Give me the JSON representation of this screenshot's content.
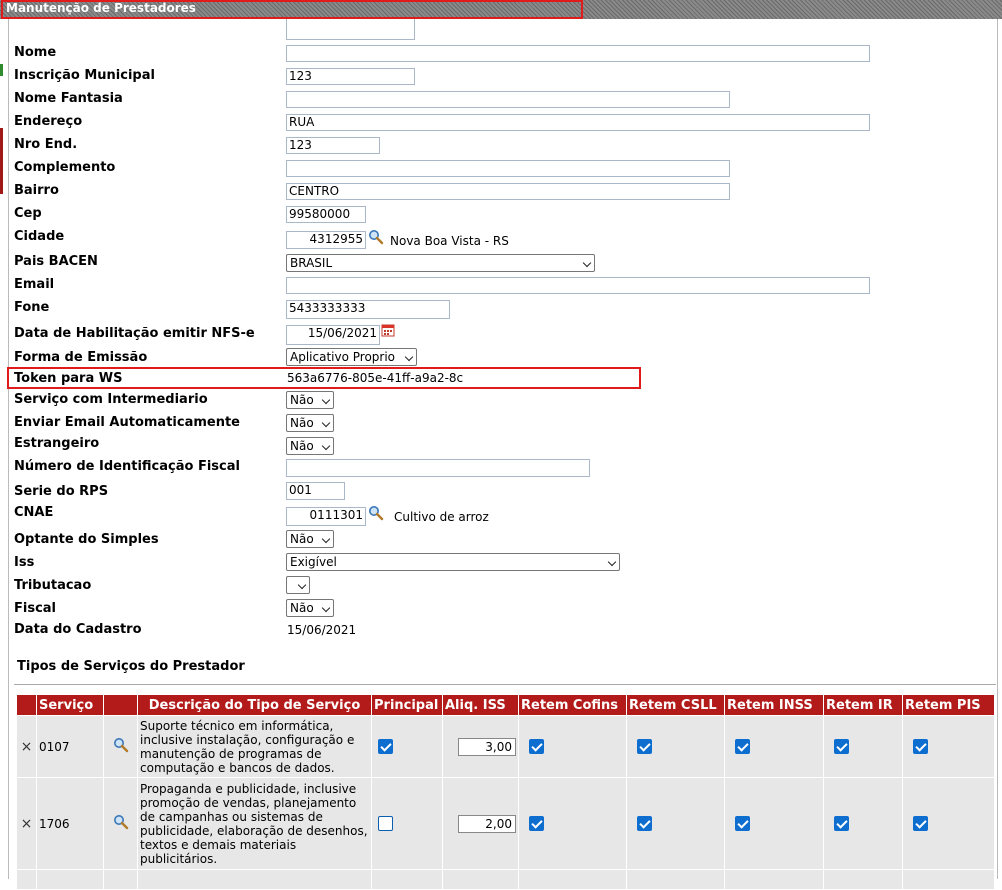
{
  "page": {
    "title": "Manutenção de Prestadores"
  },
  "form": {
    "nome": {
      "label": "Nome",
      "value": ""
    },
    "inscricao": {
      "label": "Inscrição Municipal",
      "value": "123"
    },
    "nome_fantasia": {
      "label": "Nome Fantasia",
      "value": ""
    },
    "endereco": {
      "label": "Endereço",
      "value": "RUA"
    },
    "nro": {
      "label": "Nro End.",
      "value": "123"
    },
    "complemento": {
      "label": "Complemento",
      "value": ""
    },
    "bairro": {
      "label": "Bairro",
      "value": "CENTRO"
    },
    "cep": {
      "label": "Cep",
      "value": "99580000"
    },
    "cidade": {
      "label": "Cidade",
      "code": "4312955",
      "name": "Nova Boa Vista - RS"
    },
    "pais": {
      "label": "Pais BACEN",
      "value": "BRASIL"
    },
    "email": {
      "label": "Email",
      "value": ""
    },
    "fone": {
      "label": "Fone",
      "value": "5433333333"
    },
    "data_hab": {
      "label": "Data de Habilitação emitir NFS-e",
      "value": "15/06/2021"
    },
    "forma": {
      "label": "Forma de Emissão",
      "value": "Aplicativo Proprio"
    },
    "token": {
      "label": "Token para WS",
      "value": "563a6776-805e-41ff-a9a2-8c"
    },
    "intermediario": {
      "label": "Serviço com Intermediario",
      "value": "Não"
    },
    "enviar_email": {
      "label": "Enviar Email Automaticamente",
      "value": "Não"
    },
    "estrangeiro": {
      "label": "Estrangeiro",
      "value": "Não"
    },
    "nif": {
      "label": "Número de Identificação Fiscal",
      "value": ""
    },
    "serie": {
      "label": "Serie do RPS",
      "value": "001"
    },
    "cnae": {
      "label": "CNAE",
      "code": "0111301",
      "name": "Cultivo de arroz"
    },
    "simples": {
      "label": "Optante do Simples",
      "value": "Não"
    },
    "iss": {
      "label": "Iss",
      "value": "Exigível"
    },
    "tributacao": {
      "label": "Tributacao",
      "value": ""
    },
    "fiscal": {
      "label": "Fiscal",
      "value": "Não"
    },
    "data_cadastro": {
      "label": "Data do Cadastro",
      "value": "15/06/2021"
    }
  },
  "services": {
    "title": "Tipos de Serviços do Prestador",
    "headers": [
      "",
      "Serviço",
      "",
      "Descrição do Tipo de Serviço",
      "Principal",
      "Aliq. ISS",
      "Retem Cofins",
      "Retem CSLL",
      "Retem INSS",
      "Retem IR",
      "Retem PIS"
    ],
    "rows": [
      {
        "code": "0107",
        "desc": "Suporte técnico em informática, inclusive instalação, configuração e manutenção de programas de computação e bancos de dados.",
        "principal": true,
        "aliq": "3,00",
        "cofins": true,
        "csll": true,
        "inss": true,
        "ir": true,
        "pis": true
      },
      {
        "code": "1706",
        "desc": "Propaganda e publicidade, inclusive promoção de vendas, planejamento de campanhas ou sistemas de publicidade, elaboração de desenhos, textos e demais materiais publicitários.",
        "principal": false,
        "aliq": "2,00",
        "cofins": true,
        "csll": true,
        "inss": true,
        "ir": true,
        "pis": true
      }
    ]
  }
}
